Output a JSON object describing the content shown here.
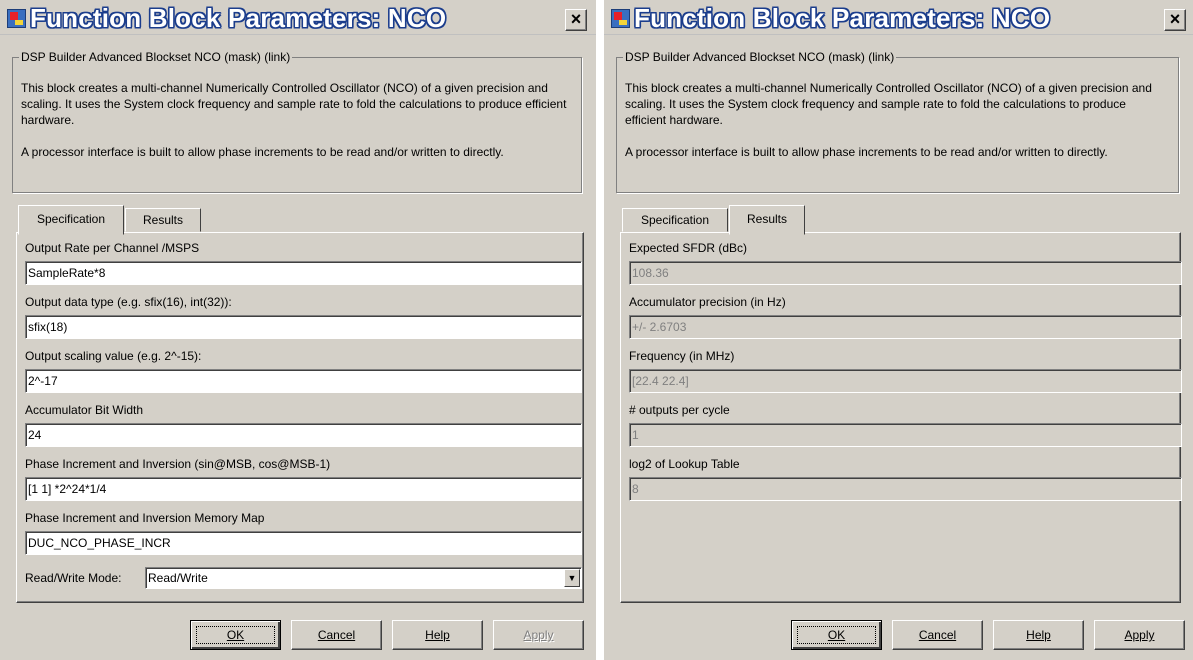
{
  "dialogs": [
    {
      "title": "Function Block Parameters: NCO",
      "close_label": "×",
      "group_label": "DSP Builder Advanced Blockset NCO (mask) (link)",
      "description": [
        "This block creates a multi-channel Numerically Controlled Oscillator (NCO) of a given precision and scaling. It uses the System clock frequency and sample rate to fold the calculations to produce efficient hardware.",
        "A processor interface is built to allow phase increments to be read and/or written to directly."
      ],
      "tabs": [
        "Specification",
        "Results"
      ],
      "active_tab": "Specification",
      "fields": [
        {
          "label": "Output Rate per Channel /MSPS",
          "value": "SampleRate*8"
        },
        {
          "label": "Output data type (e.g. sfix(16), int(32)):",
          "value": "sfix(18)"
        },
        {
          "label": "Output scaling value (e.g. 2^-15):",
          "value": "2^-17"
        },
        {
          "label": "Accumulator Bit Width",
          "value": "24"
        },
        {
          "label": "Phase Increment and Inversion (sin@MSB, cos@MSB-1)",
          "value": "[1 1] *2^24*1/4"
        },
        {
          "label": "Phase Increment and Inversion Memory Map",
          "value": "DUC_NCO_PHASE_INCR"
        }
      ],
      "select": {
        "label": "Read/Write Mode:",
        "value": "Read/Write"
      },
      "buttons": {
        "ok": "OK",
        "cancel": "Cancel",
        "help": "Help",
        "apply": "Apply"
      },
      "apply_enabled": false
    },
    {
      "title": "Function Block Parameters: NCO",
      "close_label": "×",
      "group_label": "DSP Builder Advanced Blockset NCO (mask) (link)",
      "description": [
        "This block creates a multi-channel Numerically Controlled Oscillator (NCO) of a given precision and scaling. It uses the System clock frequency and sample rate to fold the calculations to produce efficient hardware.",
        "A processor interface is built to allow phase increments to be read and/or written to directly."
      ],
      "tabs": [
        "Specification",
        "Results"
      ],
      "active_tab": "Results",
      "fields": [
        {
          "label": "Expected SFDR (dBc)",
          "value": "108.36"
        },
        {
          "label": "Accumulator precision (in Hz)",
          "value": "+/- 2.6703"
        },
        {
          "label": "Frequency (in MHz)",
          "value": "[22.4 22.4]"
        },
        {
          "label": "# outputs per cycle",
          "value": "1"
        },
        {
          "label": "log2 of Lookup Table",
          "value": "8"
        }
      ],
      "buttons": {
        "ok": "OK",
        "cancel": "Cancel",
        "help": "Help",
        "apply": "Apply"
      },
      "apply_enabled": true
    }
  ],
  "colors": {
    "face": "#d4d0c8",
    "title_outline": "#1b3d8c",
    "disabled_text": "#808080"
  },
  "icons": {
    "app": "simulink-block-icon",
    "close": "close-icon",
    "dropdown": "chevron-down-icon"
  }
}
